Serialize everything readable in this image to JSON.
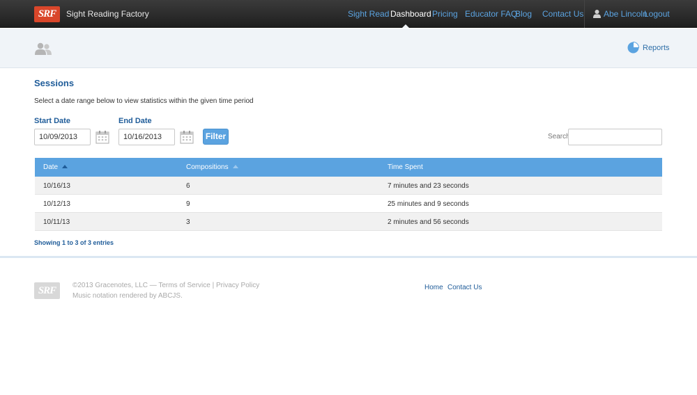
{
  "navbar": {
    "logo_text": "SRF",
    "brand": "Sight Reading Factory",
    "links": {
      "sight_read": "Sight Read",
      "dashboard": "Dashboard",
      "pricing": "Pricing",
      "educator_faq": "Educator FAQ",
      "blog": "Blog",
      "contact_us": "Contact Us"
    },
    "active_link": "Dashboard",
    "user_name": "Abe Lincoln",
    "logout": "Logout"
  },
  "subheader": {
    "left_icon": "people-icon",
    "reports_icon": "pie-chart-icon",
    "reports_label": "Reports"
  },
  "sessions": {
    "title": "Sessions",
    "intro": "Select a date range below to view statistics within the given time period",
    "start_label": "Start Date",
    "start_value": "10/09/2013",
    "end_label": "End Date",
    "end_value": "10/16/2013",
    "filter_label": "Filter",
    "search_label": "Search:",
    "search_value": ""
  },
  "table": {
    "headers": {
      "date": "Date",
      "compositions": "Compositions",
      "time_spent": "Time Spent"
    },
    "rows": [
      {
        "date": "10/16/13",
        "compositions": "6",
        "time_spent": "7 minutes and 23 seconds"
      },
      {
        "date": "10/12/13",
        "compositions": "9",
        "time_spent": "25 minutes and 9 seconds"
      },
      {
        "date": "10/11/13",
        "compositions": "3",
        "time_spent": "2 minutes and 56 seconds"
      }
    ],
    "info": "Showing 1 to 3 of 3 entries"
  },
  "footer": {
    "logo_text": "SRF",
    "copyright_line": "©2013 Gracenotes, LLC — Terms of Service | Privacy Policy",
    "notation_line": "Music notation rendered by ABCJS.",
    "home": "Home",
    "contact_us": "Contact Us"
  },
  "colors": {
    "accent": "#5ba3e0",
    "navbar": "#2a2a2a",
    "brand_red": "#d9462a",
    "title_blue": "#1f5c99"
  }
}
